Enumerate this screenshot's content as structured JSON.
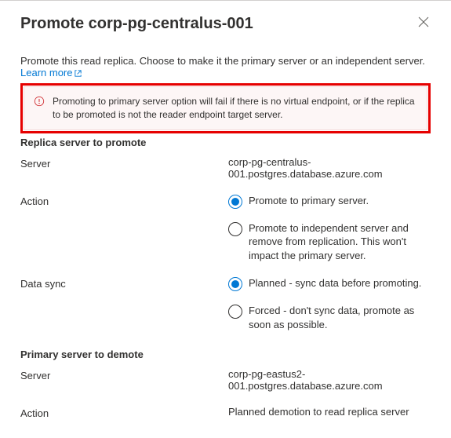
{
  "header": {
    "title": "Promote corp-pg-centralus-001"
  },
  "intro": {
    "text": "Promote this read replica. Choose to make it the primary server or an independent server.",
    "learnMore": "Learn more"
  },
  "callout": {
    "text": "Promoting to primary server option will fail if there is no virtual endpoint, or if the replica to be promoted is not the reader endpoint target server."
  },
  "replica": {
    "heading": "Replica server to promote",
    "serverLabel": "Server",
    "serverValue": "corp-pg-centralus-001.postgres.database.azure.com",
    "actionLabel": "Action",
    "actionOptions": [
      "Promote to primary server.",
      "Promote to independent server and remove from replication. This won't impact the primary server."
    ],
    "dataSyncLabel": "Data sync",
    "dataSyncOptions": [
      "Planned - sync data before promoting.",
      "Forced - don't sync data, promote as soon as possible."
    ]
  },
  "primary": {
    "heading": "Primary server to demote",
    "serverLabel": "Server",
    "serverValue": "corp-pg-eastus2-001.postgres.database.azure.com",
    "actionLabel": "Action",
    "actionValue": "Planned demotion to read replica server"
  }
}
